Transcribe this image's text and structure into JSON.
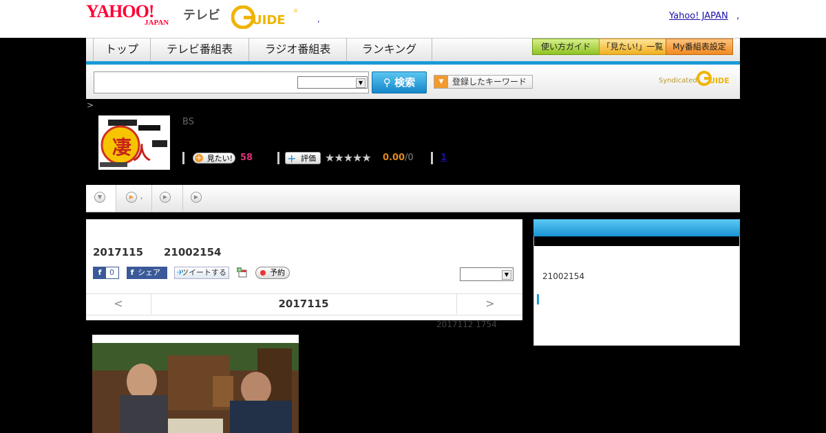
{
  "header": {
    "yahoo_logo": "YAHOO!",
    "yahoo_sub": "JAPAN",
    "tv_label": "テレビ",
    "gguide_logo": "G GUIDE",
    "header_dot": ",",
    "yahoo_japan_link": "Yahoo! JAPAN",
    "yahoo_japan_sep": ","
  },
  "nav": {
    "tabs": [
      "トップ",
      "テレビ番組表",
      "ラジオ番組表",
      "ランキング"
    ],
    "buttons": {
      "guide": "使い方ガイド",
      "mitai_list": "「見たい!」一覧",
      "my_schedule": "My番組表設定"
    }
  },
  "search": {
    "placeholder": "",
    "select_value": "",
    "search_button": "検索",
    "keyword_button": "登録したキーワード",
    "syndicated": "Syndicated"
  },
  "breadcrumb": ">",
  "program": {
    "channel": "BS",
    "mitai_label": "見たい!",
    "mitai_count": "58",
    "hyoka_label": "評価",
    "stars": "★★★★★",
    "score": "0.00",
    "score_den": "/0",
    "review_count": "1"
  },
  "tabs_row": {
    "tab2_label": ","
  },
  "episode": {
    "date": "2017115",
    "id": "21002154",
    "fb_like_count": "0",
    "fb_share": "シェア",
    "tweet": "ツイートする",
    "yoyaku": "予約",
    "select_value": "",
    "prev": "<",
    "nav_date": "2017115",
    "next": ">",
    "updated": "2017112  1754"
  },
  "sidebar": {
    "id": "21002154"
  },
  "colors": {
    "accent_blue": "#1a9ad6",
    "mitai_pink": "#e0307a",
    "score_orange": "#e08a20",
    "yahoo_red": "#ff0033"
  }
}
